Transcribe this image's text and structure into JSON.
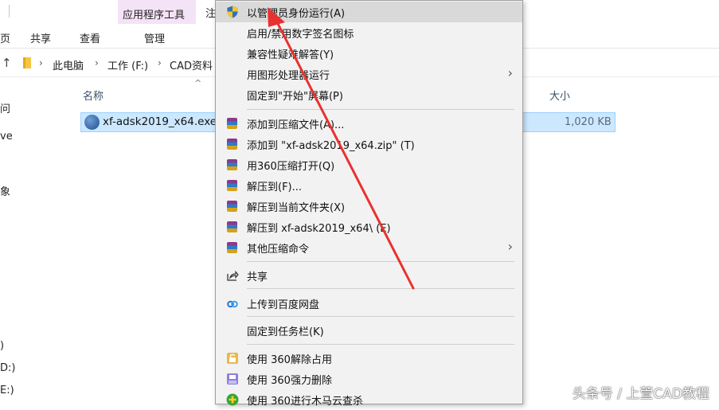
{
  "ribbon": {
    "tools_tab": "应用程序工具",
    "tab_fragment": "注",
    "tabs": [
      "页",
      "共享",
      "查看",
      "管理"
    ]
  },
  "address": {
    "up_arrow": "↑",
    "crumbs": [
      "此电脑",
      "工作 (F:)",
      "CAD资料"
    ],
    "sep": "›"
  },
  "nav_fragments": [
    "问",
    "ve",
    "象",
    ")",
    "D:)",
    "E:)"
  ],
  "file_list": {
    "name_header": "名称",
    "size_header": "大小",
    "sort_indicator": "^",
    "file_name": "xf-adsk2019_x64.exe",
    "file_size": "1,020 KB"
  },
  "menu": {
    "items": [
      {
        "label": "以管理员身份运行(A)",
        "icon": "uac-shield-icon"
      },
      {
        "label": "启用/禁用数字签名图标"
      },
      {
        "label": "兼容性疑难解答(Y)"
      },
      {
        "label": "用图形处理器运行",
        "submenu": "›"
      },
      {
        "label": "固定到\"开始\"屏幕(P)"
      },
      {
        "label": "添加到压缩文件(A)...",
        "icon": "archive-icon"
      },
      {
        "label": "添加到 \"xf-adsk2019_x64.zip\" (T)",
        "icon": "archive-icon"
      },
      {
        "label": "用360压缩打开(Q)",
        "icon": "archive-icon"
      },
      {
        "label": "解压到(F)...",
        "icon": "archive-icon"
      },
      {
        "label": "解压到当前文件夹(X)",
        "icon": "archive-icon"
      },
      {
        "label": "解压到 xf-adsk2019_x64\\ (E)",
        "icon": "archive-icon"
      },
      {
        "label": "其他压缩命令",
        "icon": "archive-icon",
        "submenu": "›"
      },
      {
        "label": "共享",
        "icon": "share-icon"
      },
      {
        "label": "上传到百度网盘",
        "icon": "baidu-cloud-icon"
      },
      {
        "label": "固定到任务栏(K)"
      },
      {
        "label": "使用 360解除占用",
        "icon": "unlock-360-icon"
      },
      {
        "label": "使用 360强力删除",
        "icon": "shred-360-icon"
      },
      {
        "label": "使用 360进行木马云查杀",
        "icon": "trojan-scan-360-icon"
      }
    ]
  },
  "watermark": "头条号 / 上萱CAD教程",
  "colors": {
    "tools_tab_bg": "#f4e2f6",
    "selection_bg": "#cce8ff",
    "menu_bg": "#f2f2f2",
    "menu_highlight": "#d9d9d9",
    "arrow_red": "#e8322f"
  }
}
